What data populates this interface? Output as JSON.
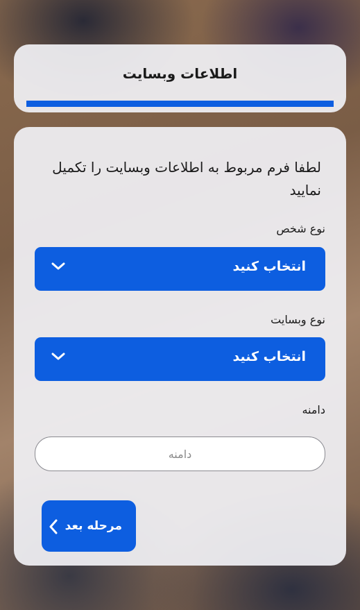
{
  "header": {
    "title": "اطلاعات وبسایت",
    "progress_percent": 100
  },
  "form": {
    "intro": "لطفا فرم مربوط به اطلاعات وبسایت را تکمیل نمایید",
    "person_type": {
      "label": "نوع شخص",
      "value": "انتخاب کنید",
      "icon": "chevron-down-icon"
    },
    "website_type": {
      "label": "نوع وبسایت",
      "value": "انتخاب کنید",
      "icon": "chevron-down-icon"
    },
    "domain": {
      "label": "دامنه",
      "placeholder": "دامنه",
      "value": ""
    },
    "next_button": {
      "label": "مرحله بعد",
      "icon": "chevron-left-icon"
    }
  },
  "colors": {
    "accent": "#0d5ee0",
    "card": "#f0f0f4"
  }
}
